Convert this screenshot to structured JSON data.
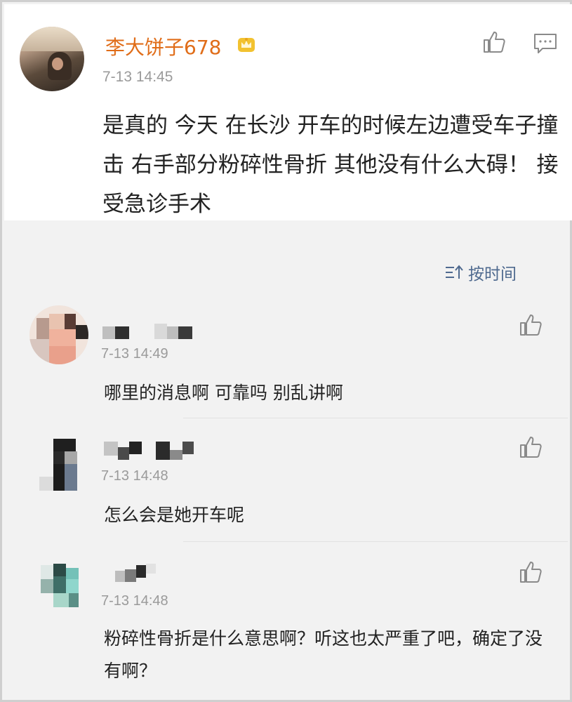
{
  "post": {
    "username": "李大饼子678",
    "time": "7-13 14:45",
    "body": "是真的 今天 在长沙 开车的时候左边遭受车子撞击 右手部分粉碎性骨折 其他没有什么大碍！ 接受急诊手术",
    "badge_icon": "crown-icon",
    "accent_color": "#e06d19"
  },
  "sort": {
    "label": "按时间",
    "icon": "sort-icon"
  },
  "comments": [
    {
      "time": "7-13 14:49",
      "text": "哪里的消息啊 可靠吗 别乱讲啊"
    },
    {
      "time": "7-13 14:48",
      "text": "怎么会是她开车呢"
    },
    {
      "time": "7-13 14:48",
      "text": "粉碎性骨折是什么意思啊？听这也太严重了吧，确定了没有啊？"
    }
  ]
}
